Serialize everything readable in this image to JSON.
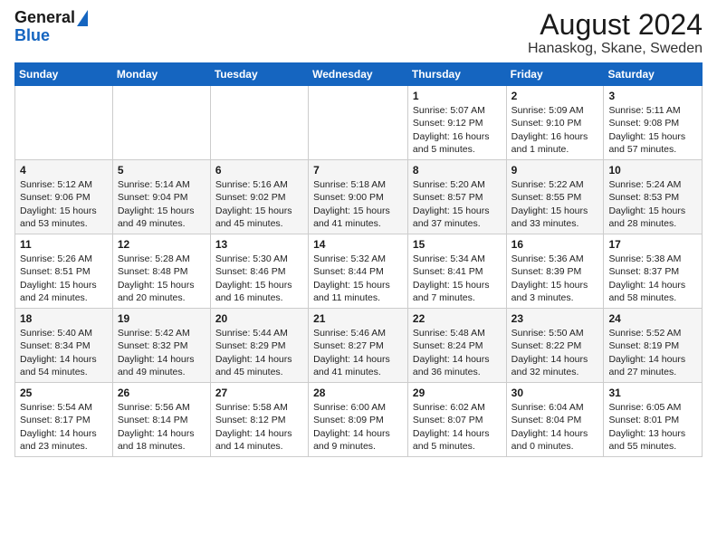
{
  "logo": {
    "line1": "General",
    "line2": "Blue"
  },
  "title": "August 2024",
  "subtitle": "Hanaskog, Skane, Sweden",
  "weekdays": [
    "Sunday",
    "Monday",
    "Tuesday",
    "Wednesday",
    "Thursday",
    "Friday",
    "Saturday"
  ],
  "weeks": [
    [
      {
        "day": "",
        "info": ""
      },
      {
        "day": "",
        "info": ""
      },
      {
        "day": "",
        "info": ""
      },
      {
        "day": "",
        "info": ""
      },
      {
        "day": "1",
        "info": "Sunrise: 5:07 AM\nSunset: 9:12 PM\nDaylight: 16 hours\nand 5 minutes."
      },
      {
        "day": "2",
        "info": "Sunrise: 5:09 AM\nSunset: 9:10 PM\nDaylight: 16 hours\nand 1 minute."
      },
      {
        "day": "3",
        "info": "Sunrise: 5:11 AM\nSunset: 9:08 PM\nDaylight: 15 hours\nand 57 minutes."
      }
    ],
    [
      {
        "day": "4",
        "info": "Sunrise: 5:12 AM\nSunset: 9:06 PM\nDaylight: 15 hours\nand 53 minutes."
      },
      {
        "day": "5",
        "info": "Sunrise: 5:14 AM\nSunset: 9:04 PM\nDaylight: 15 hours\nand 49 minutes."
      },
      {
        "day": "6",
        "info": "Sunrise: 5:16 AM\nSunset: 9:02 PM\nDaylight: 15 hours\nand 45 minutes."
      },
      {
        "day": "7",
        "info": "Sunrise: 5:18 AM\nSunset: 9:00 PM\nDaylight: 15 hours\nand 41 minutes."
      },
      {
        "day": "8",
        "info": "Sunrise: 5:20 AM\nSunset: 8:57 PM\nDaylight: 15 hours\nand 37 minutes."
      },
      {
        "day": "9",
        "info": "Sunrise: 5:22 AM\nSunset: 8:55 PM\nDaylight: 15 hours\nand 33 minutes."
      },
      {
        "day": "10",
        "info": "Sunrise: 5:24 AM\nSunset: 8:53 PM\nDaylight: 15 hours\nand 28 minutes."
      }
    ],
    [
      {
        "day": "11",
        "info": "Sunrise: 5:26 AM\nSunset: 8:51 PM\nDaylight: 15 hours\nand 24 minutes."
      },
      {
        "day": "12",
        "info": "Sunrise: 5:28 AM\nSunset: 8:48 PM\nDaylight: 15 hours\nand 20 minutes."
      },
      {
        "day": "13",
        "info": "Sunrise: 5:30 AM\nSunset: 8:46 PM\nDaylight: 15 hours\nand 16 minutes."
      },
      {
        "day": "14",
        "info": "Sunrise: 5:32 AM\nSunset: 8:44 PM\nDaylight: 15 hours\nand 11 minutes."
      },
      {
        "day": "15",
        "info": "Sunrise: 5:34 AM\nSunset: 8:41 PM\nDaylight: 15 hours\nand 7 minutes."
      },
      {
        "day": "16",
        "info": "Sunrise: 5:36 AM\nSunset: 8:39 PM\nDaylight: 15 hours\nand 3 minutes."
      },
      {
        "day": "17",
        "info": "Sunrise: 5:38 AM\nSunset: 8:37 PM\nDaylight: 14 hours\nand 58 minutes."
      }
    ],
    [
      {
        "day": "18",
        "info": "Sunrise: 5:40 AM\nSunset: 8:34 PM\nDaylight: 14 hours\nand 54 minutes."
      },
      {
        "day": "19",
        "info": "Sunrise: 5:42 AM\nSunset: 8:32 PM\nDaylight: 14 hours\nand 49 minutes."
      },
      {
        "day": "20",
        "info": "Sunrise: 5:44 AM\nSunset: 8:29 PM\nDaylight: 14 hours\nand 45 minutes."
      },
      {
        "day": "21",
        "info": "Sunrise: 5:46 AM\nSunset: 8:27 PM\nDaylight: 14 hours\nand 41 minutes."
      },
      {
        "day": "22",
        "info": "Sunrise: 5:48 AM\nSunset: 8:24 PM\nDaylight: 14 hours\nand 36 minutes."
      },
      {
        "day": "23",
        "info": "Sunrise: 5:50 AM\nSunset: 8:22 PM\nDaylight: 14 hours\nand 32 minutes."
      },
      {
        "day": "24",
        "info": "Sunrise: 5:52 AM\nSunset: 8:19 PM\nDaylight: 14 hours\nand 27 minutes."
      }
    ],
    [
      {
        "day": "25",
        "info": "Sunrise: 5:54 AM\nSunset: 8:17 PM\nDaylight: 14 hours\nand 23 minutes."
      },
      {
        "day": "26",
        "info": "Sunrise: 5:56 AM\nSunset: 8:14 PM\nDaylight: 14 hours\nand 18 minutes."
      },
      {
        "day": "27",
        "info": "Sunrise: 5:58 AM\nSunset: 8:12 PM\nDaylight: 14 hours\nand 14 minutes."
      },
      {
        "day": "28",
        "info": "Sunrise: 6:00 AM\nSunset: 8:09 PM\nDaylight: 14 hours\nand 9 minutes."
      },
      {
        "day": "29",
        "info": "Sunrise: 6:02 AM\nSunset: 8:07 PM\nDaylight: 14 hours\nand 5 minutes."
      },
      {
        "day": "30",
        "info": "Sunrise: 6:04 AM\nSunset: 8:04 PM\nDaylight: 14 hours\nand 0 minutes."
      },
      {
        "day": "31",
        "info": "Sunrise: 6:05 AM\nSunset: 8:01 PM\nDaylight: 13 hours\nand 55 minutes."
      }
    ]
  ]
}
